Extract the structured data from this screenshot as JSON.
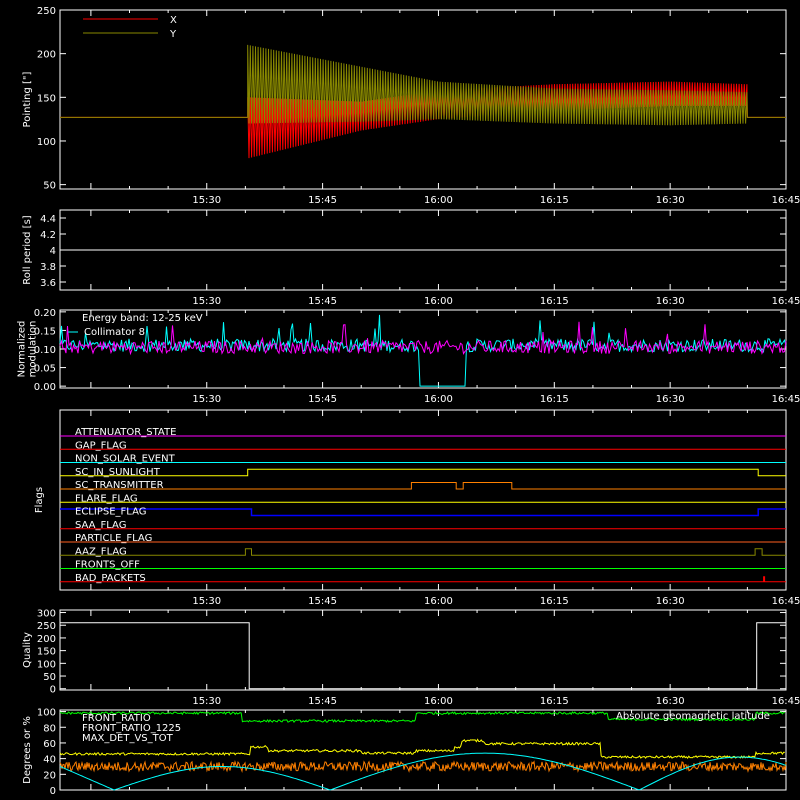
{
  "chart_data": [
    {
      "type": "line",
      "ylabel": "Pointing [\"]",
      "ylim": [
        45,
        250
      ],
      "yticks": [
        50,
        100,
        150,
        200,
        250
      ],
      "xtick_labels": [
        "15:30",
        "15:45",
        "16:00",
        "16:15",
        "16:30",
        "16:45"
      ],
      "xlim_minutes": [
        911,
        1005
      ],
      "legend": "top-left",
      "series": [
        {
          "name": "X",
          "color": "#ff0000",
          "baseline": 127,
          "segments": [
            {
              "t": 935.3,
              "lo": 80,
              "hi": 150
            },
            {
              "t": 950,
              "lo": 112,
              "hi": 145
            },
            {
              "t": 960,
              "lo": 125,
              "hi": 158
            },
            {
              "t": 975,
              "lo": 135,
              "hi": 165
            },
            {
              "t": 990,
              "lo": 140,
              "hi": 168
            },
            {
              "t": 1000,
              "lo": 140,
              "hi": 165
            }
          ]
        },
        {
          "name": "Y",
          "color": "#888800",
          "baseline": 127,
          "segments": [
            {
              "t": 935.3,
              "lo": 120,
              "hi": 210
            },
            {
              "t": 950,
              "lo": 122,
              "hi": 185
            },
            {
              "t": 960,
              "lo": 125,
              "hi": 168
            },
            {
              "t": 975,
              "lo": 120,
              "hi": 160
            },
            {
              "t": 990,
              "lo": 118,
              "hi": 158
            },
            {
              "t": 1000,
              "lo": 120,
              "hi": 156
            }
          ]
        }
      ]
    },
    {
      "type": "line",
      "ylabel": "Roll period [s]",
      "ylim": [
        3.5,
        4.5
      ],
      "yticks": [
        3.6,
        3.8,
        4.0,
        4.2,
        4.4
      ],
      "xtick_labels": [
        "15:30",
        "15:45",
        "16:00",
        "16:15",
        "16:30",
        "16:45"
      ],
      "series": [
        {
          "color": "#ffffff",
          "value": 4.0
        }
      ]
    },
    {
      "type": "line",
      "ylabel_lines": [
        "Normalized",
        "modulation"
      ],
      "ylim": [
        -0.005,
        0.205
      ],
      "yticks": [
        0.0,
        0.05,
        0.1,
        0.15,
        0.2
      ],
      "yticks_text": [
        "0.00",
        "0.05",
        "0.10",
        "0.15",
        "0.20"
      ],
      "xtick_labels": [
        "15:30",
        "15:45",
        "16:00",
        "16:15",
        "16:30",
        "16:45"
      ],
      "annotation": "Energy band: 12-25 keV",
      "series": [
        {
          "name": "Collimator 8",
          "color": "#00ffff",
          "mean": 0.11,
          "gap_minutes": [
            957.5,
            963.5
          ]
        },
        {
          "color": "#ff00ff",
          "mean": 0.105
        }
      ]
    },
    {
      "type": "line",
      "ylabel": "Flags",
      "xtick_labels": [
        "15:30",
        "15:45",
        "16:00",
        "16:15",
        "16:30",
        "16:45"
      ],
      "flags": [
        {
          "label": "ATTENUATOR_STATE",
          "color": "#ff00ff",
          "pattern": "flat"
        },
        {
          "label": "GAP_FLAG",
          "color": "#ff0000",
          "pattern": "flat"
        },
        {
          "label": "NON_SOLAR_EVENT",
          "color": "#00ffff",
          "pattern": "flat"
        },
        {
          "label": "SC_IN_SUNLIGHT",
          "color": "#ffff00",
          "pattern": "high_between",
          "on": [
            935.3,
            1001.4
          ]
        },
        {
          "label": "SC_TRANSMITTER",
          "color": "#ff8000",
          "pattern": "pulses",
          "pulses": [
            [
              956.5,
              962.3
            ],
            [
              963.2,
              969.5
            ]
          ]
        },
        {
          "label": "FLARE_FLAG",
          "color": "#ffff00",
          "pattern": "flat"
        },
        {
          "label": "ECLIPSE_FLAG",
          "color": "#0000ff",
          "pattern": "high_outside",
          "on": [
            935.8,
            1001.4
          ]
        },
        {
          "label": "SAA_FLAG",
          "color": "#ff0000",
          "pattern": "flat"
        },
        {
          "label": "PARTICLE_FLAG",
          "color": "#ff6020",
          "pattern": "flat"
        },
        {
          "label": "AAZ_FLAG",
          "color": "#888800",
          "pattern": "pulses",
          "pulses": [
            [
              935.0,
              935.8
            ],
            [
              1001.0,
              1001.9
            ]
          ]
        },
        {
          "label": "FRONTS_OFF",
          "color": "#00ff00",
          "pattern": "flat"
        },
        {
          "label": "BAD_PACKETS",
          "color": "#ff0000",
          "pattern": "spike",
          "at": 1002.1
        }
      ]
    },
    {
      "type": "line",
      "ylabel": "Quality",
      "ylim": [
        -5,
        310
      ],
      "yticks": [
        0,
        50,
        100,
        150,
        200,
        250,
        300
      ],
      "xtick_labels": [
        "15:30",
        "15:45",
        "16:00",
        "16:15",
        "16:30",
        "16:45"
      ],
      "series": [
        {
          "color": "#ffffff",
          "high": 260,
          "low": 0,
          "off": [
            935.5,
            1001.2
          ]
        }
      ]
    },
    {
      "type": "line",
      "ylabel": "Degrees or %",
      "ylim": [
        0,
        102
      ],
      "yticks": [
        0,
        20,
        40,
        60,
        80,
        100
      ],
      "xtick_labels": [],
      "series": [
        {
          "name": "FRONT_RATIO",
          "color": "#ffff00",
          "pattern": "steps",
          "steps": [
            [
              911,
              46
            ],
            [
              935.7,
              55
            ],
            [
              938,
              50
            ],
            [
              950,
              47
            ],
            [
              957,
              50
            ],
            [
              962,
              55
            ],
            [
              963,
              63
            ],
            [
              966,
              59
            ],
            [
              981,
              42
            ],
            [
              1001,
              47
            ],
            [
              1005,
              47
            ]
          ]
        },
        {
          "name": "FRONT_RATIO_1225",
          "color": "#00ff00",
          "pattern": "steps",
          "steps": [
            [
              911,
              98
            ],
            [
              934.5,
              88
            ],
            [
              957,
              98
            ],
            [
              982,
              90
            ],
            [
              1001,
              98
            ],
            [
              1005,
              98
            ]
          ]
        },
        {
          "name": "MAX_DET_VS_TOT",
          "color": "#ff8000",
          "pattern": "noise",
          "mean": 30,
          "spread": 6
        },
        {
          "name": "Absolute geomagnetic latitude",
          "color": "#00ffff",
          "pattern": "arcs",
          "zeros": [
            918,
            946,
            986
          ],
          "peaks": [
            [
              932,
              30
            ],
            [
              966,
              47
            ],
            [
              999,
              42
            ]
          ]
        }
      ]
    }
  ]
}
